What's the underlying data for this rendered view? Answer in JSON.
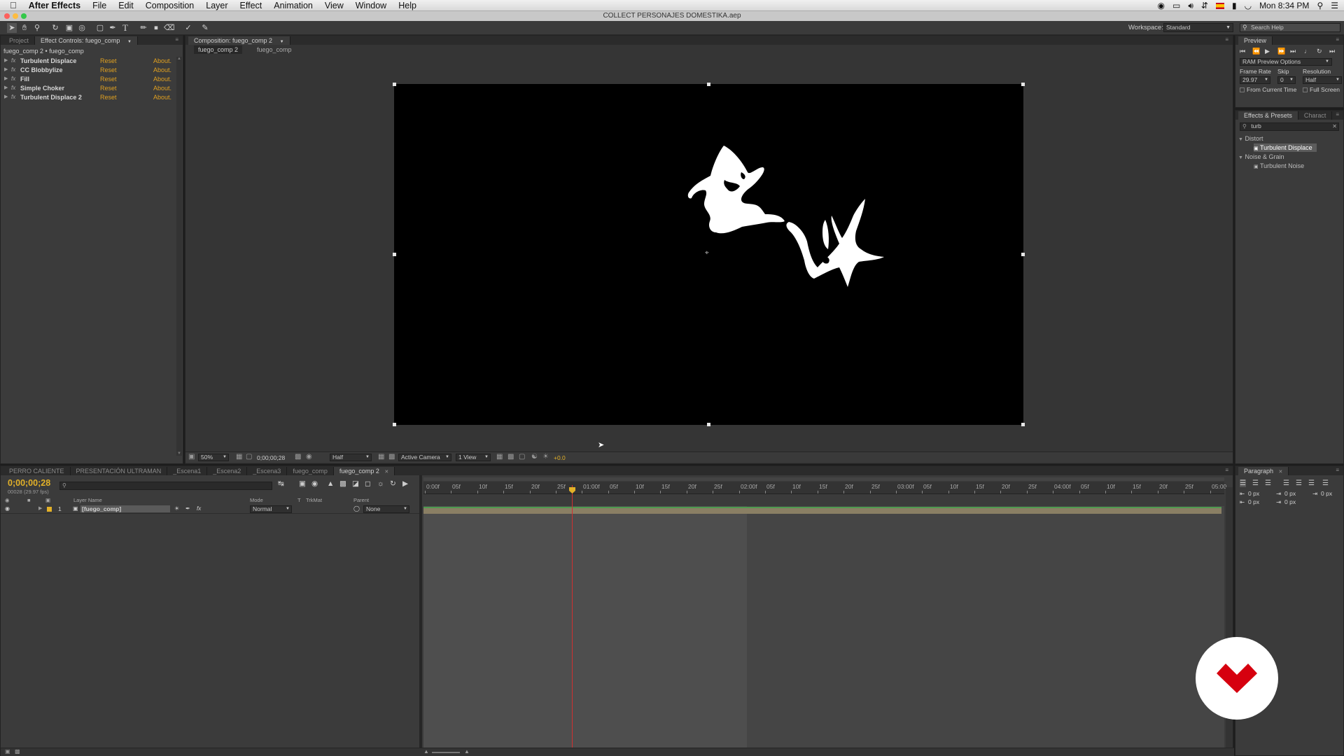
{
  "menu": {
    "app": "After Effects",
    "items": [
      "File",
      "Edit",
      "Composition",
      "Layer",
      "Effect",
      "Animation",
      "View",
      "Window",
      "Help"
    ],
    "clock": "Mon 8:34 PM"
  },
  "window_title": "COLLECT PERSONAJES DOMESTIKA.aep",
  "workspace": {
    "label": "Workspace:",
    "value": "Standard"
  },
  "search_help": "Search Help",
  "left_panel": {
    "tabs": [
      "Project",
      "Effect Controls: fuego_comp"
    ],
    "breadcrumb": "fuego_comp 2 • fuego_comp",
    "effects": [
      {
        "name": "Turbulent Displace",
        "reset": "Reset",
        "about": "About."
      },
      {
        "name": "CC Blobbylize",
        "reset": "Reset",
        "about": "About."
      },
      {
        "name": "Fill",
        "reset": "Reset",
        "about": "About."
      },
      {
        "name": "Simple Choker",
        "reset": "Reset",
        "about": "About."
      },
      {
        "name": "Turbulent Displace 2",
        "reset": "Reset",
        "about": "About."
      }
    ],
    "fx_badge": "fx"
  },
  "comp_panel": {
    "tab": "Composition: fuego_comp 2",
    "crumbs": [
      "fuego_comp 2",
      "fuego_comp"
    ],
    "zoom": "50%",
    "timecode": "0;00;00;28",
    "resolution": "Half",
    "camera": "Active Camera",
    "views": "1 View",
    "exposure": "+0.0"
  },
  "preview": {
    "tab": "Preview",
    "ram": "RAM Preview Options",
    "frame_rate_label": "Frame Rate",
    "skip_label": "Skip",
    "resolution_label": "Resolution",
    "frame_rate": "29.97",
    "skip": "0",
    "resolution": "Half",
    "from_current": "From Current Time",
    "full_screen": "Full Screen"
  },
  "effects_presets": {
    "tabs": [
      "Effects & Presets",
      "Charact"
    ],
    "search": "turb",
    "groups": [
      {
        "name": "Distort",
        "items": [
          "Turbulent Displace"
        ]
      },
      {
        "name": "Noise & Grain",
        "items": [
          "Turbulent Noise"
        ]
      }
    ]
  },
  "timeline": {
    "tabs": [
      "PERRO CALIENTE",
      "PRESENTACIÓN ULTRAMAN",
      "_Escena1",
      "_Escena2",
      "_Escena3",
      "fuego_comp",
      "fuego_comp 2"
    ],
    "timecode": "0;00;00;28",
    "fps": "00028 (29.97 fps)",
    "columns": {
      "layer_name": "Layer Name",
      "mode": "Mode",
      "t": "T",
      "trkmat": "TrkMat",
      "parent": "Parent"
    },
    "layers": [
      {
        "num": "1",
        "name": "[fuego_comp]",
        "mode": "Normal",
        "parent": "None"
      }
    ],
    "ruler": [
      "0:00f",
      "05f",
      "10f",
      "15f",
      "20f",
      "25f",
      "01:00f",
      "05f",
      "10f",
      "15f",
      "20f",
      "25f",
      "02:00f",
      "05f",
      "10f",
      "15f",
      "20f",
      "25f",
      "03:00f",
      "05f",
      "10f",
      "15f",
      "20f",
      "25f",
      "04:00f",
      "05f",
      "10f",
      "15f",
      "20f",
      "25f",
      "05:00"
    ]
  },
  "paragraph": {
    "tab": "Paragraph",
    "values": [
      "0 px",
      "0 px",
      "0 px",
      "0 px",
      "0 px"
    ]
  },
  "colors": {
    "accent": "#e3b128",
    "badge": "#d6000f"
  }
}
